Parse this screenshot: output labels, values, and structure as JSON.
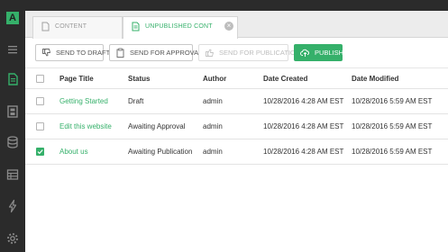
{
  "sidebar": {
    "logo_text": "A",
    "icons": [
      "menu-icon",
      "document-icon",
      "film-icon",
      "database-icon",
      "table-icon",
      "lightning-icon",
      "gear-icon"
    ]
  },
  "tabs": [
    {
      "label": "CONTENT",
      "active": false
    },
    {
      "label": "UNPUBLISHED CONT",
      "active": true
    }
  ],
  "toolbar": {
    "send_to_draft": "SEND TO DRAFT",
    "send_for_approval": "SEND FOR APPROVAL",
    "send_for_publication": "SEND FOR PUBLICATION",
    "publish": "PUBLISH"
  },
  "table": {
    "headers": {
      "title": "Page Title",
      "status": "Status",
      "author": "Author",
      "created": "Date Created",
      "modified": "Date Modified"
    },
    "rows": [
      {
        "title": "Getting Started",
        "status": "Draft",
        "author": "admin",
        "created": "10/28/2016 4:28 AM EST",
        "modified": "10/28/2016 5:59 AM EST",
        "checked": false
      },
      {
        "title": "Edit this website",
        "status": "Awaiting Approval",
        "author": "admin",
        "created": "10/28/2016 4:28 AM EST",
        "modified": "10/28/2016 5:59 AM EST",
        "checked": false
      },
      {
        "title": "About us",
        "status": "Awaiting Publication",
        "author": "admin",
        "created": "10/28/2016 4:28 AM EST",
        "modified": "10/28/2016 5:59 AM EST",
        "checked": true
      }
    ]
  },
  "colors": {
    "accent": "#35b06a",
    "sidebar": "#2b2b2b"
  }
}
